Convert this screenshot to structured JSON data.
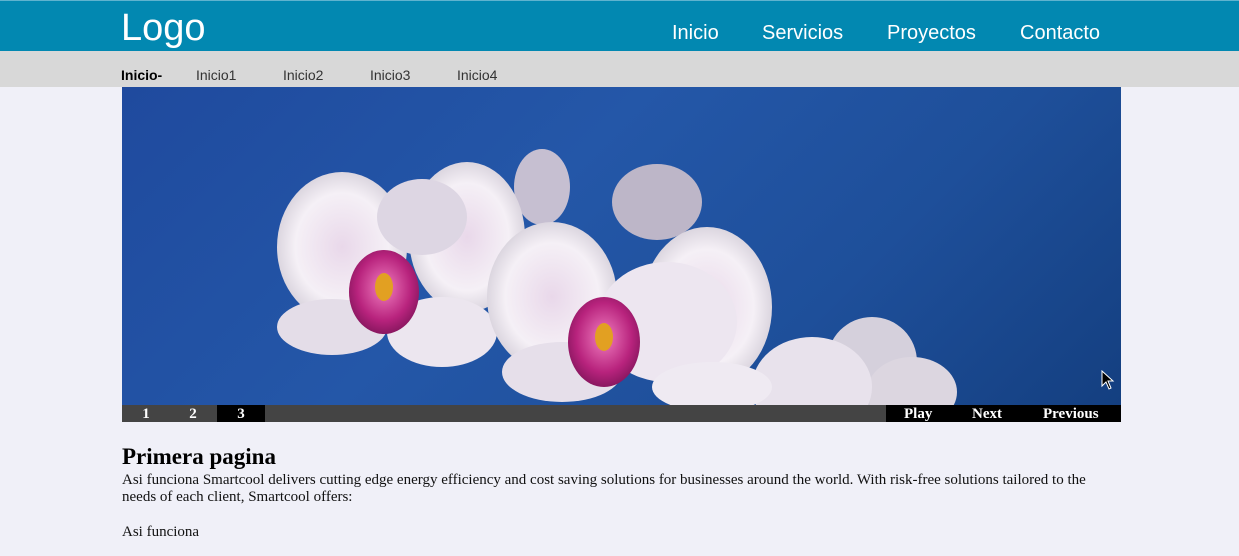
{
  "header": {
    "logo": "Logo",
    "nav": [
      "Inicio",
      "Servicios",
      "Proyectos",
      "Contacto"
    ]
  },
  "subnav": {
    "current": "Inicio-",
    "items": [
      "Inicio1",
      "Inicio2",
      "Inicio3",
      "Inicio4"
    ]
  },
  "slider": {
    "pages": [
      "1",
      "2",
      "3"
    ],
    "active_page": "3",
    "play": "Play",
    "next": "Next",
    "previous": "Previous"
  },
  "content": {
    "title": "Primera pagina",
    "paragraph": "Asi funciona Smartcool delivers cutting edge energy efficiency and cost saving solutions for businesses around the world. With risk-free solutions tailored to the needs of each client, Smartcool offers:",
    "paragraph2": "Asi funciona"
  },
  "colors": {
    "header_bg": "#0288b1",
    "subnav_bg": "#d8d8d8",
    "page_bg": "#f0f0f8",
    "controls_bg": "#444444"
  }
}
